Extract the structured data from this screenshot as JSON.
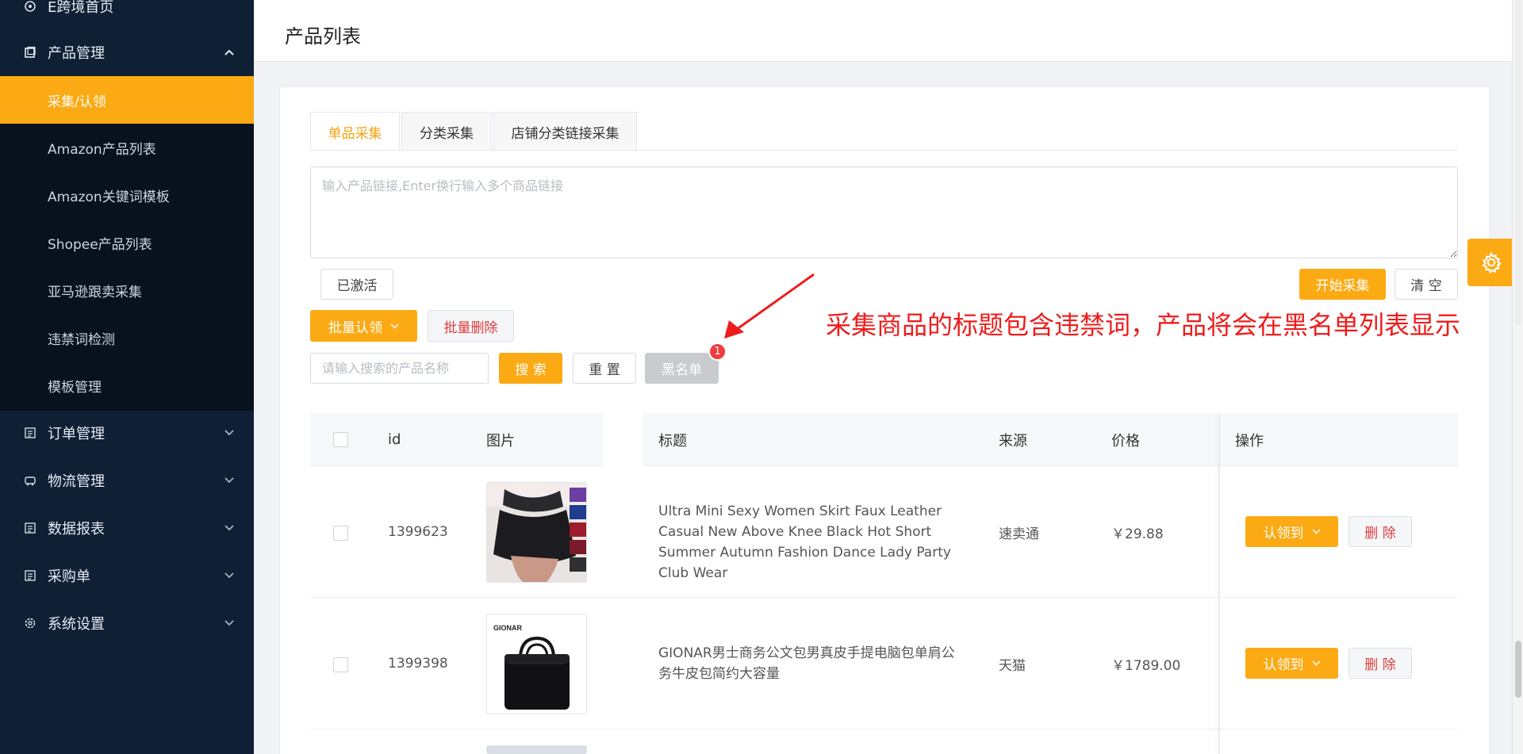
{
  "sidebar": {
    "top_item": "E跨境首页",
    "product_mgmt": "产品管理",
    "sub_items": [
      "采集/认领",
      "Amazon产品列表",
      "Amazon关键词模板",
      "Shopee产品列表",
      "亚马逊跟卖采集",
      "违禁词检测",
      "模板管理"
    ],
    "active_sub": "采集/认领",
    "groups": [
      "订单管理",
      "物流管理",
      "数据报表",
      "采购单",
      "系统设置"
    ]
  },
  "header": {
    "title": "产品列表"
  },
  "tabs": [
    "单品采集",
    "分类采集",
    "店铺分类链接采集"
  ],
  "url_input": {
    "placeholder": "输入产品链接,Enter换行输入多个商品链接"
  },
  "buttons": {
    "activated": "已激活",
    "start_collect": "开始采集",
    "clear": "清 空",
    "batch_claim": "批量认领",
    "batch_delete": "批量删除",
    "search": "搜 索",
    "reset": "重 置",
    "blacklist": "黑名单",
    "blacklist_badge": "1"
  },
  "search": {
    "placeholder": "请输入搜索的产品名称"
  },
  "annotation": "采集商品的标题包含违禁词，产品将会在黑名单列表显示",
  "table": {
    "headers": {
      "id": "id",
      "image": "图片",
      "title": "标题",
      "source": "来源",
      "price": "价格",
      "actions": "操作"
    },
    "rows": [
      {
        "id": "1399623",
        "title": "Ultra Mini Sexy Women Skirt Faux Leather Casual New Above Knee Black Hot Short Summer Autumn Fashion Dance Lady Party Club Wear",
        "source": "速卖通",
        "price": "￥29.88",
        "claim_label": "认领到",
        "delete_label": "删 除"
      },
      {
        "id": "1399398",
        "title": "GIONAR男士商务公文包男真皮手提电脑包单肩公务牛皮包简约大容量",
        "source": "天猫",
        "price": "￥1789.00",
        "claim_label": "认领到",
        "delete_label": "删 除",
        "image_brand": "GIONAR"
      }
    ]
  },
  "colors": {
    "accent": "#fbaa14",
    "sidebar_bg": "#0f2034",
    "annotation": "#ee1c1c"
  }
}
